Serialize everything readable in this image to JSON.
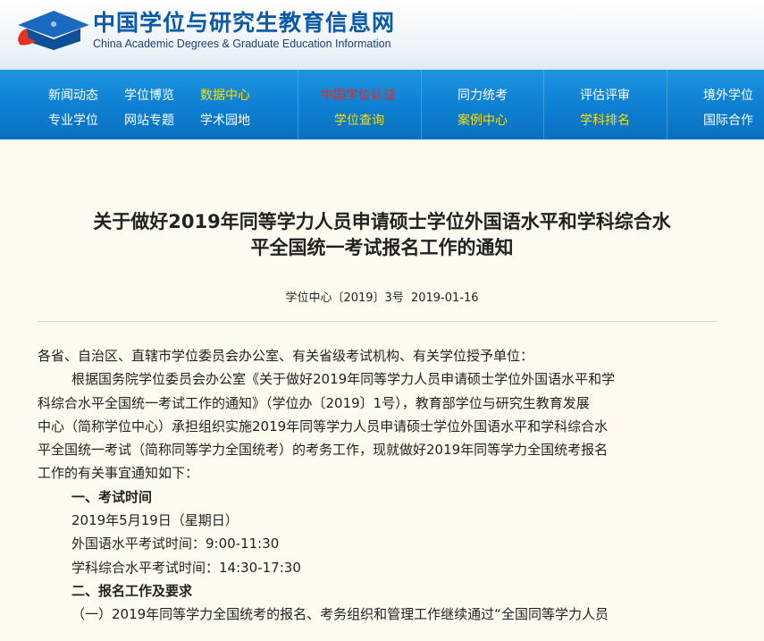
{
  "header": {
    "title": "中国学位与研究生教育信息网",
    "subtitle": "China Academic Degrees & Graduate Education Information"
  },
  "nav": {
    "col1": [
      "新闻动态",
      "学位博览",
      "数据中心",
      "专业学位",
      "网站专题",
      "学术园地"
    ],
    "col2": [
      "中国学位认证",
      "学位查询"
    ],
    "col3": [
      "同力统考",
      "案例中心"
    ],
    "col4": [
      "评估评审",
      "学科排名"
    ],
    "col5": [
      "境外学位",
      "国际合作"
    ]
  },
  "article": {
    "title_line1": "关于做好2019年同等学力人员申请硕士学位外国语水平和学科综合水",
    "title_line2": "平全国统一考试报名工作的通知",
    "doc_no": "学位中心〔2019〕3号",
    "date": "2019-01-16",
    "salutation": "各省、自治区、直辖市学位委员会办公室、有关省级考试机构、有关学位授予单位：",
    "para1_l1": "根据国务院学位委员会办公室《关于做好2019年同等学力人员申请硕士学位外国语水平和学",
    "para1_l2": "科综合水平全国统一考试工作的通知》（学位办〔2019〕1号），教育部学位与研究生教育发展",
    "para1_l3": "中心（简称学位中心）承担组织实施2019年同等学力人员申请硕士学位外国语水平和学科综合水",
    "para1_l4": "平全国统一考试（简称同等学力全国统考）的考务工作，现就做好2019年同等学力全国统考报名",
    "para1_l5": "工作的有关事宜通知如下：",
    "sec1": "一、考试时间",
    "sec1_date": "2019年5月19日（星期日）",
    "sec1_lang": "外国语水平考试时间：9:00-11:30",
    "sec1_subj": "学科综合水平考试时间：14:30-17:30",
    "sec2": "二、报名工作及要求",
    "sec2_p1": "（一）2019年同等学力全国统考的报名、考务组织和管理工作继续通过“全国同等学力人员"
  }
}
